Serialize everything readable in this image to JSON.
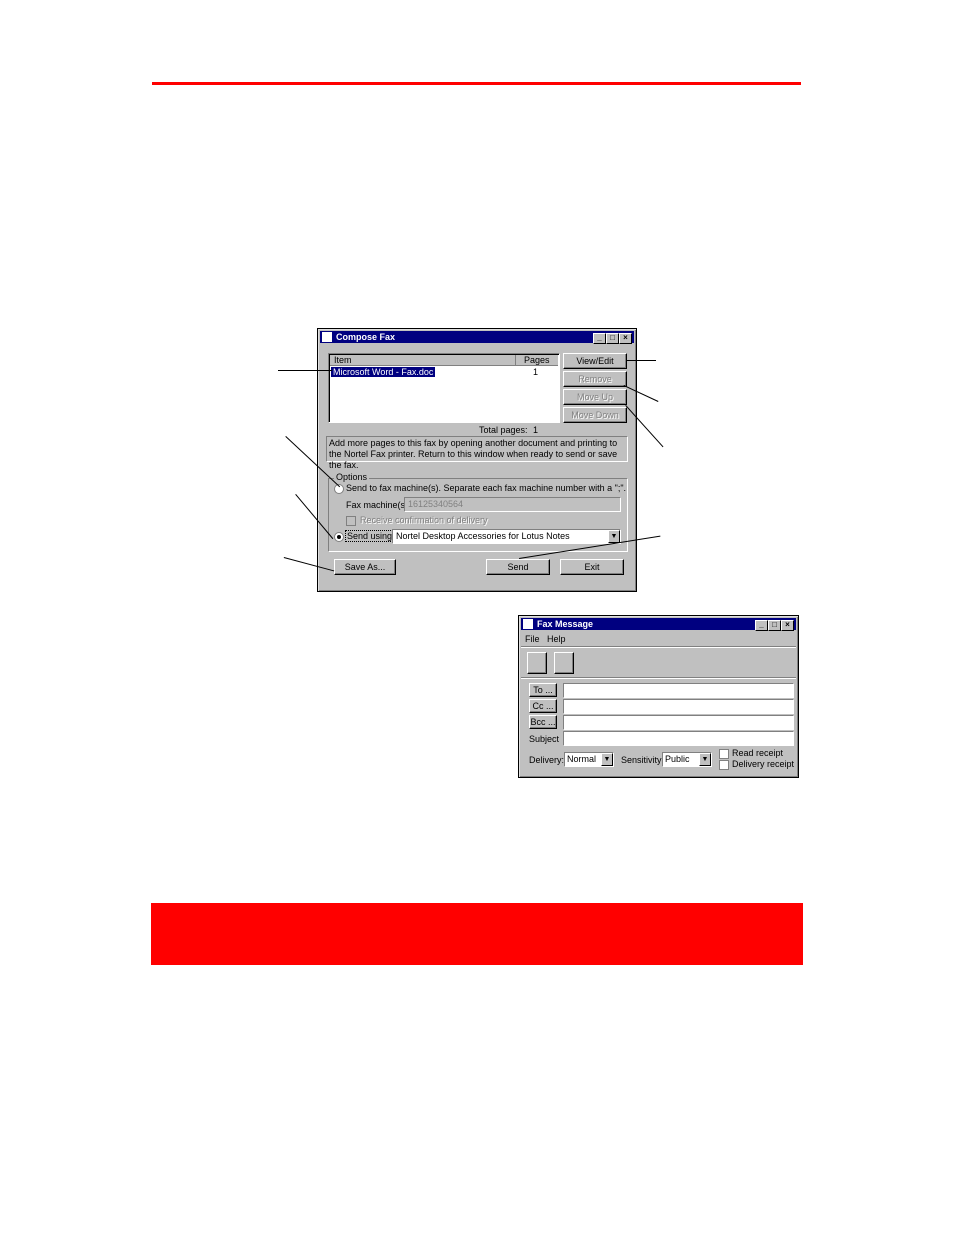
{
  "compose": {
    "title": "Compose Fax",
    "list_header_item": "Item",
    "list_header_pages": "Pages",
    "list_items": [
      {
        "name": "Microsoft Word - Fax.doc",
        "pages": "1"
      }
    ],
    "total_pages_label": "Total pages:",
    "total_pages_value": "1",
    "info_text": "Add more pages to this fax by opening another document and printing to the Nortel Fax printer. Return to this window when ready to send or save the fax.",
    "btn_view_edit": "View/Edit",
    "btn_remove": "Remove",
    "btn_move_up": "Move Up",
    "btn_move_down": "Move Down",
    "options_label": "Options",
    "radio_send_fax": "Send to fax machine(s). Separate each fax machine number with a \";\".",
    "fax_machines_label": "Fax machine(s):",
    "fax_machines_value": "16125340564",
    "confirm_delivery": "Receive confirmation of delivery",
    "radio_send_using": "Send using:",
    "send_using_value": "Nortel Desktop Accessories for Lotus Notes",
    "btn_save_as": "Save As...",
    "btn_send": "Send",
    "btn_exit": "Exit"
  },
  "message": {
    "title": "Fax Message",
    "menu_file": "File",
    "menu_help": "Help",
    "btn_to": "To ...",
    "btn_cc": "Cc ...",
    "btn_bcc": "Bcc ...",
    "subject_label": "Subject",
    "delivery_label": "Delivery:",
    "delivery_value": "Normal",
    "sensitivity_label": "Sensitivity:",
    "sensitivity_value": "Public",
    "read_receipt": "Read receipt",
    "delivery_receipt": "Delivery receipt"
  },
  "colors": {
    "accent_red": "#ff0000",
    "title_blue": "#000080"
  }
}
